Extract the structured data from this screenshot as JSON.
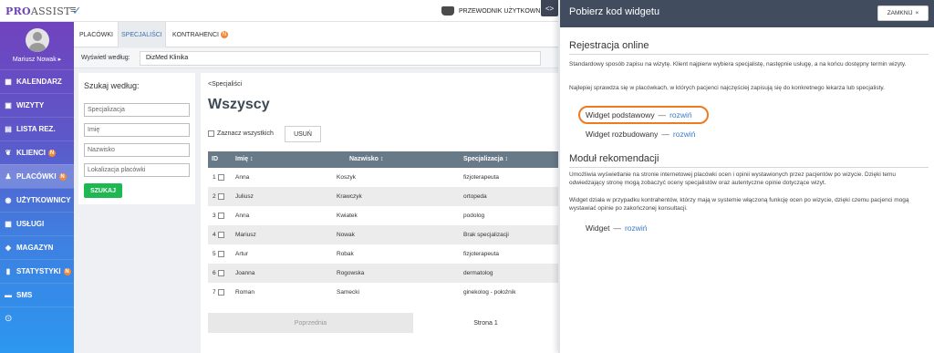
{
  "topbar": {
    "logo_pro": "PRO",
    "logo_assist": "ASSIST",
    "guide_label": "PRZEWODNIK UŻYTKOWN"
  },
  "sidebar": {
    "user_name": "Mariusz Nowak ▸",
    "items": [
      {
        "label": "KALENDARZ",
        "icon": "calendar-icon",
        "badge": ""
      },
      {
        "label": "WIZYTY",
        "icon": "visits-icon",
        "badge": ""
      },
      {
        "label": "LISTA REZ.",
        "icon": "list-icon",
        "badge": ""
      },
      {
        "label": "KLIENCI",
        "icon": "clients-icon",
        "badge": "N"
      },
      {
        "label": "PLACÓWKI",
        "icon": "facilities-icon",
        "badge": "N"
      },
      {
        "label": "UŻYTKOWNICY",
        "icon": "users-icon",
        "badge": ""
      },
      {
        "label": "USŁUGI",
        "icon": "services-icon",
        "badge": ""
      },
      {
        "label": "MAGAZYN",
        "icon": "warehouse-icon",
        "badge": ""
      },
      {
        "label": "STATYSTYKI",
        "icon": "stats-icon",
        "badge": "N"
      },
      {
        "label": "SMS",
        "icon": "sms-icon",
        "badge": ""
      }
    ]
  },
  "tabs": [
    {
      "label": "PLACÓWKI"
    },
    {
      "label": "SPECJALIŚCI"
    },
    {
      "label": "KONTRAHENCI",
      "badge": "N"
    }
  ],
  "filter": {
    "label": "Wyświetl według:",
    "value": "DizMed Klinika"
  },
  "search": {
    "title": "Szukaj według:",
    "fields": [
      "Specjalizacja",
      "Imię",
      "Nazwisko",
      "Lokalizacja placówki"
    ],
    "button": "SZUKAJ"
  },
  "main": {
    "breadcrumb": "<Specjaliści",
    "title": "Wszyscy",
    "select_all": "Zaznacz wszystkich",
    "delete_button": "USUŃ",
    "columns": [
      "ID",
      "Imię ↕",
      "Nazwisko ↕",
      "Specjalizacja ↕"
    ],
    "rows": [
      {
        "id": "1",
        "first": "Anna",
        "last": "Koszyk",
        "spec": "fizjoterapeuta"
      },
      {
        "id": "2",
        "first": "Juliusz",
        "last": "Krawczyk",
        "spec": "ortopeda"
      },
      {
        "id": "3",
        "first": "Anna",
        "last": "Kwiatek",
        "spec": "podolog"
      },
      {
        "id": "4",
        "first": "Mariusz",
        "last": "Nowak",
        "spec": "Brak specjalizacji"
      },
      {
        "id": "5",
        "first": "Artur",
        "last": "Robak",
        "spec": "fizjoterapeuta"
      },
      {
        "id": "6",
        "first": "Joanna",
        "last": "Rogowska",
        "spec": "dermatolog"
      },
      {
        "id": "7",
        "first": "Roman",
        "last": "Samecki",
        "spec": "ginekolog - położnik"
      }
    ],
    "pager_prev": "Poprzednia",
    "pager_current": "Strona 1"
  },
  "panel": {
    "title": "Pobierz kod widgetu",
    "close_button": "ZAMKNIJ",
    "section1": {
      "title": "Rejestracja online",
      "p1": "Standardowy sposób zapisu na wizytę. Klient najpierw wybiera specjalistę, następnie usługę, a na końcu dostępny termin wizyty.",
      "p2": "Najlepiej sprawdza się w placówkach, w których pacjenci najczęściej zapisują się do konkretnego lekarza lub specjalisty.",
      "link1_label": "Widget podstawowy",
      "link2_label": "Widget rozbudowany",
      "separator": "—",
      "expand": "rozwiń"
    },
    "section2": {
      "title": "Moduł rekomendacji",
      "p1": "Umożliwia wyświetlanie na stronie internetowej placówki ocen i opinii wystawionych przez pacjentów po wizycie. Dzięki temu odwiedzający stronę mogą zobaczyć oceny specjalistów oraz autentyczne opinie dotyczące wizyt.",
      "p2": "Widget działa w przypadku kontrahentów, którzy mają w systemie włączoną funkcję ocen po wizycie, dzięki czemu pacjenci mogą wystawiać opinie po zakończonej konsultacji.",
      "link_label": "Widget",
      "separator": "—",
      "expand": "rozwiń"
    }
  },
  "colors": {
    "accent": "#6c43b8",
    "highlight": "#ee7a22",
    "success": "#1eb852",
    "panel_header": "#414d5f"
  }
}
